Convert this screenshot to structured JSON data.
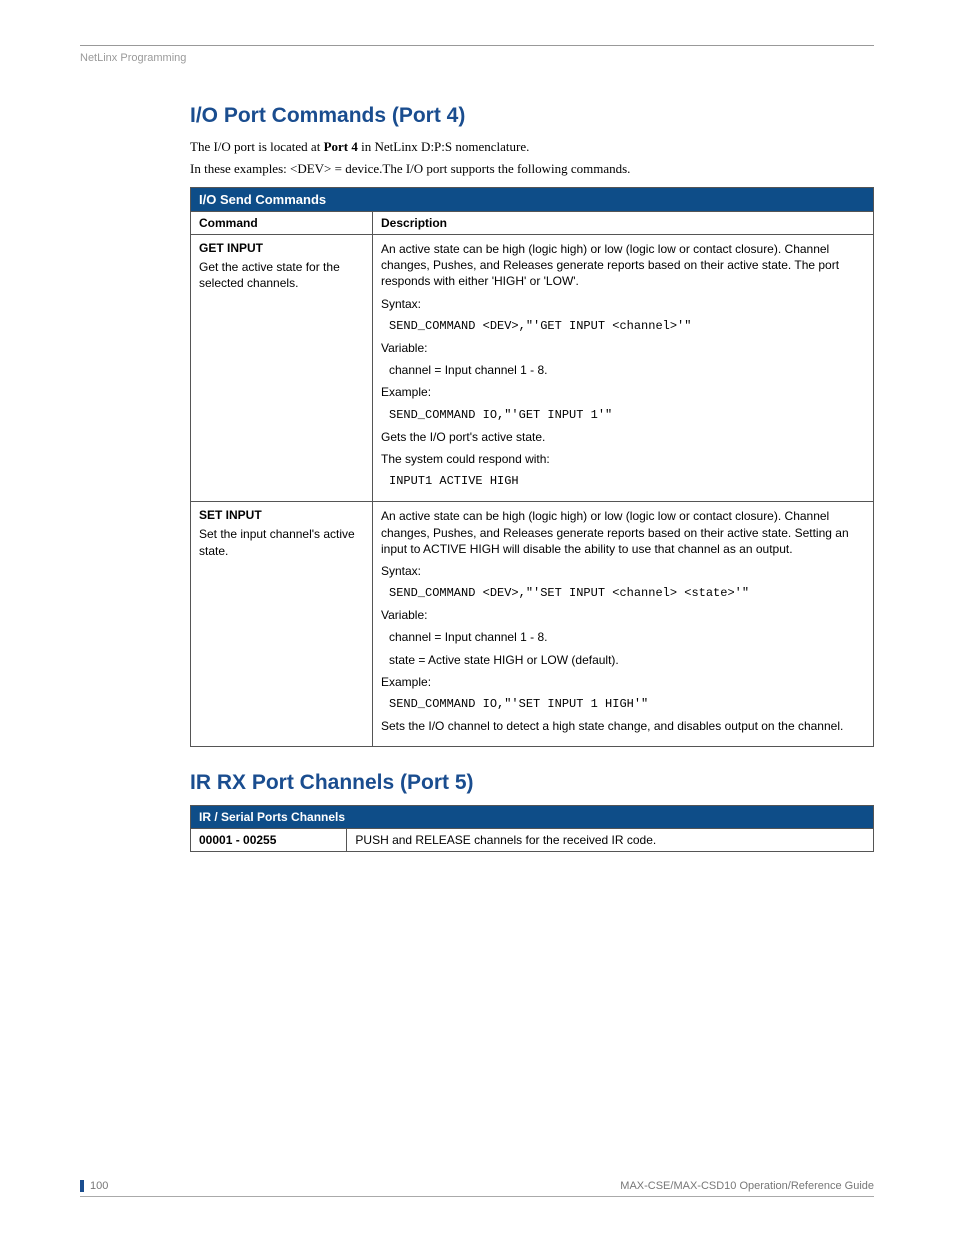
{
  "header": {
    "breadcrumb": "NetLinx Programming"
  },
  "section1": {
    "title": "I/O Port Commands (Port 4)",
    "intro_line1_a": "The I/O port is located at ",
    "intro_line1_b": "Port 4",
    "intro_line1_c": " in NetLinx D:P:S nomenclature.",
    "intro_line2": "In these examples: <DEV> = device.The I/O port supports the following commands.",
    "table_title": "I/O Send Commands",
    "col1": "Command",
    "col2": "Description",
    "rows": [
      {
        "cmd": "GET INPUT",
        "cmd_sub": "Get the active state for the selected channels.",
        "desc_p1": "An active state can be high (logic high) or low (logic low or contact closure). Channel changes, Pushes, and Releases generate reports based on their active state. The port responds with either 'HIGH' or 'LOW'.",
        "syntax_label": "Syntax:",
        "syntax_code": "SEND_COMMAND <DEV>,\"'GET INPUT <channel>'\"",
        "variable_label": "Variable:",
        "variable_text1": "channel = Input channel 1 - 8.",
        "example_label": "Example:",
        "example_code": "SEND_COMMAND IO,\"'GET INPUT 1'\"",
        "result1": "Gets the I/O port's active state.",
        "result2": "The system could respond with:",
        "result_code": "INPUT1 ACTIVE HIGH"
      },
      {
        "cmd": "SET INPUT",
        "cmd_sub": "Set the input channel's active state.",
        "desc_p1": "An active state can be high (logic high) or low (logic low or contact closure). Channel changes, Pushes, and Releases generate reports based on their active state. Setting an input to ACTIVE HIGH will disable the ability to use that channel as an output.",
        "syntax_label": "Syntax:",
        "syntax_code": "SEND_COMMAND <DEV>,\"'SET INPUT <channel> <state>'\"",
        "variable_label": "Variable:",
        "variable_text1": "channel = Input channel 1 - 8.",
        "variable_text2": "state = Active state HIGH or LOW (default).",
        "example_label": "Example:",
        "example_code": "SEND_COMMAND IO,\"'SET INPUT 1 HIGH'\"",
        "result1": "Sets the I/O channel to detect a high state change, and disables output on the channel."
      }
    ]
  },
  "section2": {
    "title": "IR RX Port Channels (Port 5)",
    "table_title": "IR / Serial Ports Channels",
    "row": {
      "col1": "00001 - 00255",
      "col2": "PUSH and RELEASE channels for the received IR code."
    }
  },
  "footer": {
    "pagenum": "100",
    "guide": "MAX-CSE/MAX-CSD10 Operation/Reference Guide"
  }
}
